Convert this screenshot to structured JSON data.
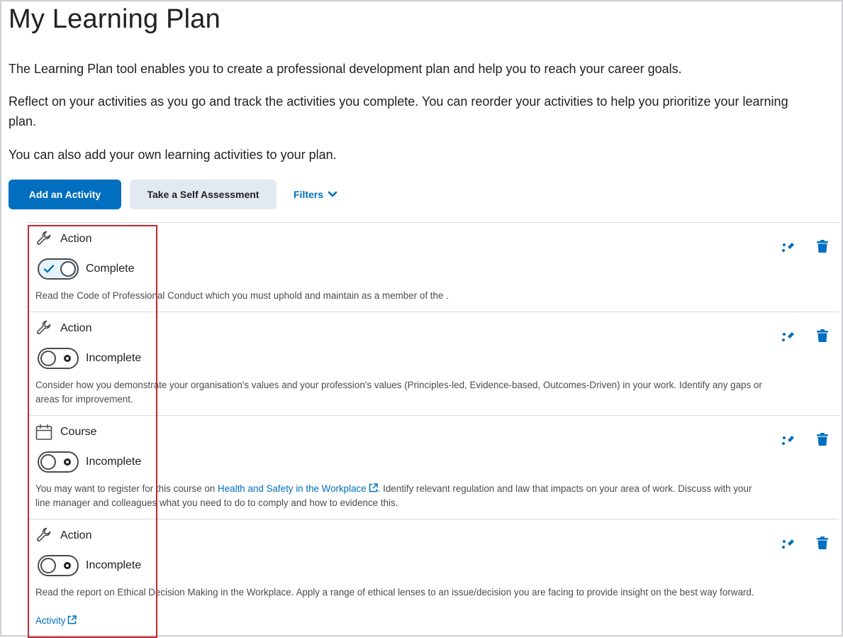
{
  "page": {
    "title": "My Learning Plan",
    "intro": [
      "The Learning Plan tool enables you to create a professional development plan and help you to reach your career goals.",
      "Reflect on your activities as you go and track the activities you complete. You can reorder your activities to help you prioritize your learning plan.",
      "You can also add your own learning activities to your plan."
    ]
  },
  "toolbar": {
    "add_activity_label": "Add an Activity",
    "self_assessment_label": "Take a Self Assessment",
    "filters_label": "Filters"
  },
  "colors": {
    "primary": "#006fbf",
    "secondary_button_bg": "#e3e9f1",
    "highlight_border": "#c0282d"
  },
  "activities": [
    {
      "type": "Action",
      "icon": "wrench-icon",
      "status": "Complete",
      "complete": true,
      "description": "Read the  Code of Professional Conduct which you must uphold and maintain as a member of the ."
    },
    {
      "type": "Action",
      "icon": "wrench-icon",
      "status": "Incomplete",
      "complete": false,
      "description": "Consider how you demonstrate your organisation's values and your profession's values (Principles-led, Evidence-based, Outcomes-Driven) in your work. Identify any gaps or areas for improvement."
    },
    {
      "type": "Course",
      "icon": "calendar-icon",
      "status": "Incomplete",
      "complete": false,
      "description_before": "You may want to register for this course on ",
      "link_text": "Health and Safety in the Workplace",
      "description_after": ". Identify relevant regulation and law that impacts on your area of work. Discuss with your line manager and colleagues what you need to do to comply and  how to evidence this."
    },
    {
      "type": "Action",
      "icon": "wrench-icon",
      "status": "Incomplete",
      "complete": false,
      "description": "Read the  report on Ethical Decision Making in the Workplace. Apply a range of ethical lenses to an issue/decision you are facing to provide insight on the best way forward.",
      "link_text": "Activity"
    }
  ]
}
